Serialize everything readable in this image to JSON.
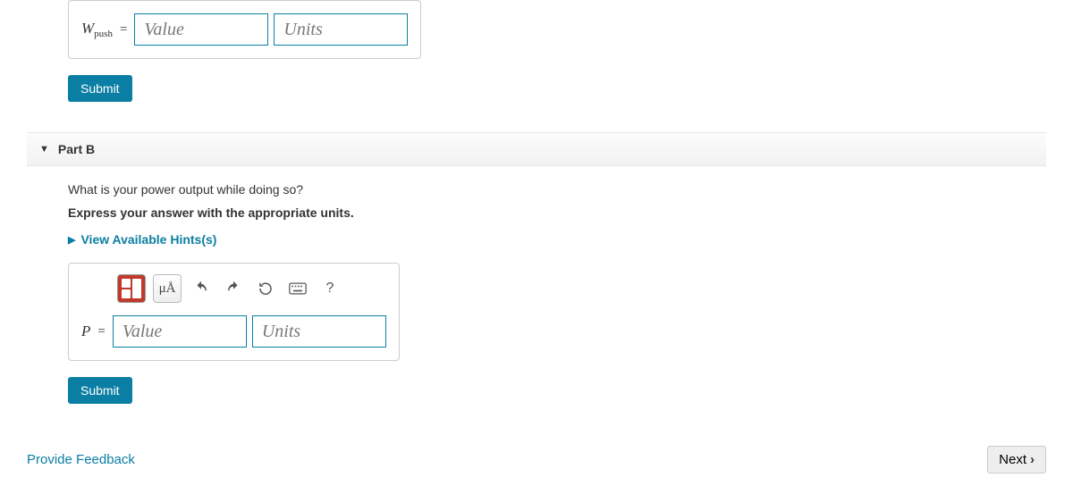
{
  "partA": {
    "variable_html": "W",
    "subscript": "push",
    "equals": "=",
    "value_placeholder": "Value",
    "units_placeholder": "Units",
    "submit_label": "Submit"
  },
  "partB": {
    "header_title": "Part B",
    "question": "What is your power output while doing so?",
    "instruction": "Express your answer with the appropriate units.",
    "hints_label": "View Available Hints(s)",
    "toolbar": {
      "templates_name": "templates-icon",
      "mu_label": "μÅ",
      "undo_name": "undo-icon",
      "redo_name": "redo-icon",
      "reset_name": "reset-icon",
      "keyboard_name": "keyboard-icon",
      "help_label": "?"
    },
    "variable": "P",
    "equals": "=",
    "value_placeholder": "Value",
    "units_placeholder": "Units",
    "submit_label": "Submit"
  },
  "footer": {
    "feedback_label": "Provide Feedback",
    "next_label": "Next"
  }
}
